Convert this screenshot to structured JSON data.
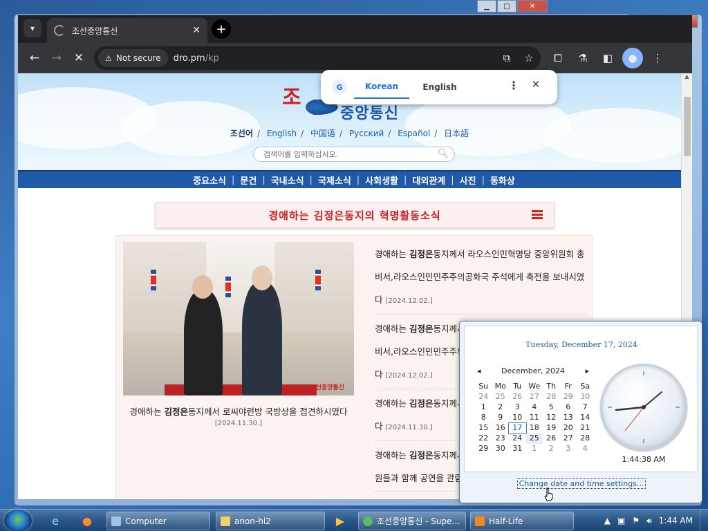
{
  "browser": {
    "tab_title": "조선중앙통신",
    "tab_close": "✕",
    "new_tab": "+",
    "security_chip": "Not secure",
    "url_host": "dro.pm",
    "url_path": "/kp"
  },
  "translate": {
    "lang_source": "Korean",
    "lang_target": "English",
    "g_label": "G"
  },
  "site": {
    "logo_red": "조",
    "logo_blue": "중앙통신",
    "languages": [
      "조선어",
      "English",
      "中国语",
      "Русский",
      "Español",
      "日本語"
    ],
    "search_placeholder": "검색어를 입력하십시오.",
    "nav": [
      "중요소식",
      "문건",
      "국내소식",
      "국제소식",
      "사회생활",
      "대외관계",
      "사진",
      "동화상"
    ],
    "headline": "경애하는 김정은동지의 혁명활동소식"
  },
  "feature": {
    "photo_logo": "조선중앙통신",
    "caption_pre": "경애하는 ",
    "caption_bold": "김정은",
    "caption_post": "동지께서 로씨야련방 국방상을 접견하시였다",
    "date": "[2024.11.30.]"
  },
  "news": [
    {
      "pre": "경애하는 ",
      "bold": "김정은",
      "text": "동지께서 라오스인민혁명당 중앙위원회 총비서,라오스인민민주주의공화국 주석에게 축전을 보내시였다",
      "date": "[2024.12.02.]"
    },
    {
      "pre": "경애하는 ",
      "bold": "김정은",
      "text": "동지께서 라오스인민혁명당 중앙위원회 총비서,라오스인민민주주의공화국 주석에게 축전을 보내시였다",
      "date": "[2024.12.02.]"
    },
    {
      "pre": "경애하는 ",
      "bold": "김정은",
      "text": "동지께서 로씨야련방 국방상을 접견하시였다",
      "date": "[2024.11.30.]"
    },
    {
      "pre": "경애하는 ",
      "bold": "김정은",
      "text": "동지께서 로씨야련방 국방상과 대표단 성원들과 함께 공연을 관람하시였다",
      "date": ""
    }
  ],
  "clock": {
    "full_date": "Tuesday, December 17, 2024",
    "month_label": "December, 2024",
    "prev": "◂",
    "next": "▸",
    "weekdays": [
      "Su",
      "Mo",
      "Tu",
      "We",
      "Th",
      "Fr",
      "Sa"
    ],
    "weeks": [
      [
        "24",
        "25",
        "26",
        "27",
        "28",
        "29",
        "30"
      ],
      [
        "1",
        "2",
        "3",
        "4",
        "5",
        "6",
        "7"
      ],
      [
        "8",
        "9",
        "10",
        "11",
        "12",
        "13",
        "14"
      ],
      [
        "15",
        "16",
        "17",
        "18",
        "19",
        "20",
        "21"
      ],
      [
        "22",
        "23",
        "24",
        "25",
        "26",
        "27",
        "28"
      ],
      [
        "29",
        "30",
        "31",
        "1",
        "2",
        "3",
        "4"
      ]
    ],
    "time": "1:44:38 AM",
    "change_link": "Change date and time settings..."
  },
  "taskbar": {
    "tasks": [
      "Computer",
      "anon-hl2",
      "조선중앙통신 - Supe...",
      "Half-Life"
    ],
    "tray_time": "1:44 AM"
  },
  "bg_window": {
    "min": "▁",
    "max": "□",
    "close": "✕"
  },
  "colors": {
    "nav_blue": "#1e5aa8",
    "headline_red": "#cc2222",
    "chrome_dark": "#202124",
    "link_blue": "#1a73e8"
  }
}
